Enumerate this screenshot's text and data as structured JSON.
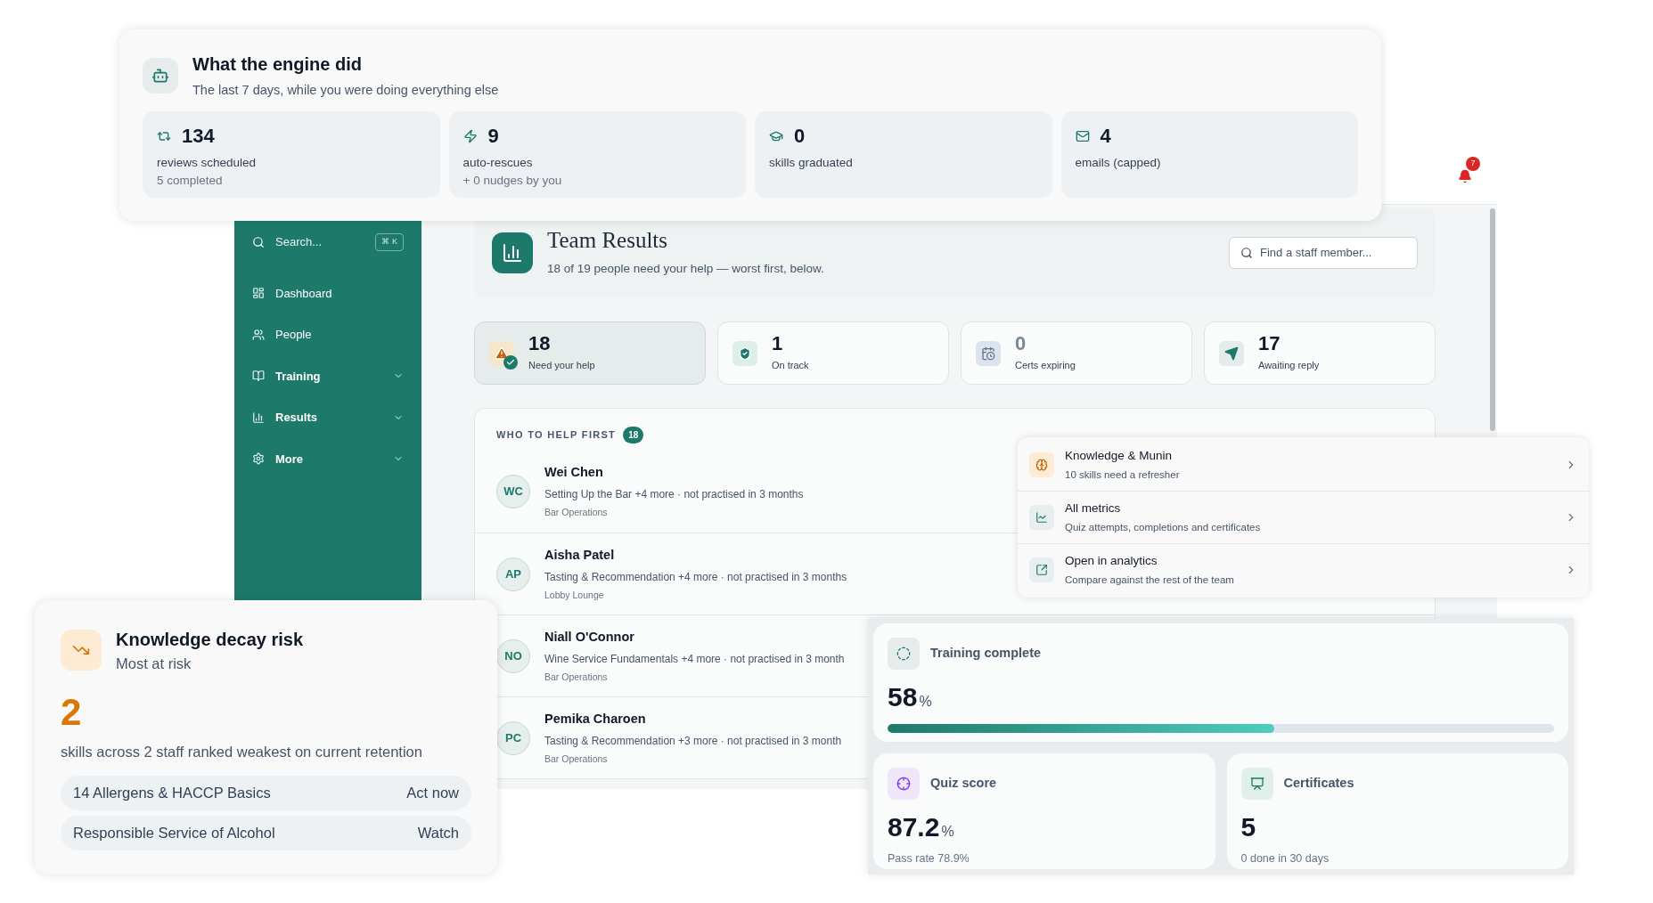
{
  "engine": {
    "title": "What the engine did",
    "subtitle": "The last 7 days, while you were doing everything else",
    "stats": [
      {
        "value": "134",
        "label": "reviews scheduled",
        "sub": "5 completed"
      },
      {
        "value": "9",
        "label": "auto-rescues",
        "sub": "+ 0 nudges by you"
      },
      {
        "value": "0",
        "label": "skills graduated"
      },
      {
        "value": "4",
        "label": "emails (capped)"
      }
    ]
  },
  "topbar": {
    "notifications": "7"
  },
  "sidebar": {
    "search": {
      "placeholder": "Search...",
      "shortcut": "⌘ K"
    },
    "items": [
      {
        "label": "Dashboard",
        "kind": "link"
      },
      {
        "label": "People",
        "kind": "link"
      },
      {
        "label": "Training",
        "kind": "group"
      },
      {
        "label": "Results",
        "kind": "group"
      },
      {
        "label": "More",
        "kind": "group"
      }
    ]
  },
  "team": {
    "title": "Team Results",
    "subtitle": "18 of 19 people need your help — worst first, below.",
    "search": {
      "placeholder": "Find a staff member..."
    },
    "stats": [
      {
        "value": "18",
        "label": "Need your help",
        "selected": true,
        "muted": false
      },
      {
        "value": "1",
        "label": "On track",
        "selected": false,
        "muted": false
      },
      {
        "value": "0",
        "label": "Certs expiring",
        "selected": false,
        "muted": true
      },
      {
        "value": "17",
        "label": "Awaiting reply",
        "selected": false,
        "muted": false
      }
    ]
  },
  "help_list": {
    "heading": "WHO TO HELP FIRST",
    "count": "18",
    "people": [
      {
        "initials": "WC",
        "name": "Wei Chen",
        "detail": "Setting Up the Bar +4 more · not practised in 3 months",
        "team": "Bar Operations"
      },
      {
        "initials": "AP",
        "name": "Aisha Patel",
        "detail": "Tasting & Recommendation +4 more · not practised in 3 months",
        "team": "Lobby Lounge"
      },
      {
        "initials": "NO",
        "name": "Niall O'Connor",
        "detail": "Wine Service Fundamentals +4 more · not practised in 3 month",
        "team": "Bar Operations"
      },
      {
        "initials": "PC",
        "name": "Pemika Charoen",
        "detail": "Tasting & Recommendation +3 more · not practised in 3 month",
        "team": "Bar Operations"
      }
    ]
  },
  "decay": {
    "title": "Knowledge decay risk",
    "subtitle": "Most at risk",
    "count": "2",
    "description": "skills across 2 staff ranked weakest on current retention",
    "skills": [
      {
        "name": "14 Allergens & HACCP Basics",
        "status": "Act now"
      },
      {
        "name": "Responsible Service of Alcohol",
        "status": "Watch"
      }
    ]
  },
  "links": [
    {
      "title": "Knowledge & Munin",
      "subtitle": "10 skills need a refresher"
    },
    {
      "title": "All metrics",
      "subtitle": "Quiz attempts, completions and certificates"
    },
    {
      "title": "Open in analytics",
      "subtitle": "Compare against the rest of the team"
    }
  ],
  "metrics": {
    "training": {
      "label": "Training complete",
      "value": "58",
      "unit": "%",
      "level": 0.58
    },
    "quiz": {
      "label": "Quiz score",
      "value": "87.2",
      "unit": "%",
      "sub": "Pass rate 78.9%"
    },
    "certificates": {
      "label": "Certificates",
      "value": "5",
      "sub": "0 done in 30 days"
    }
  }
}
